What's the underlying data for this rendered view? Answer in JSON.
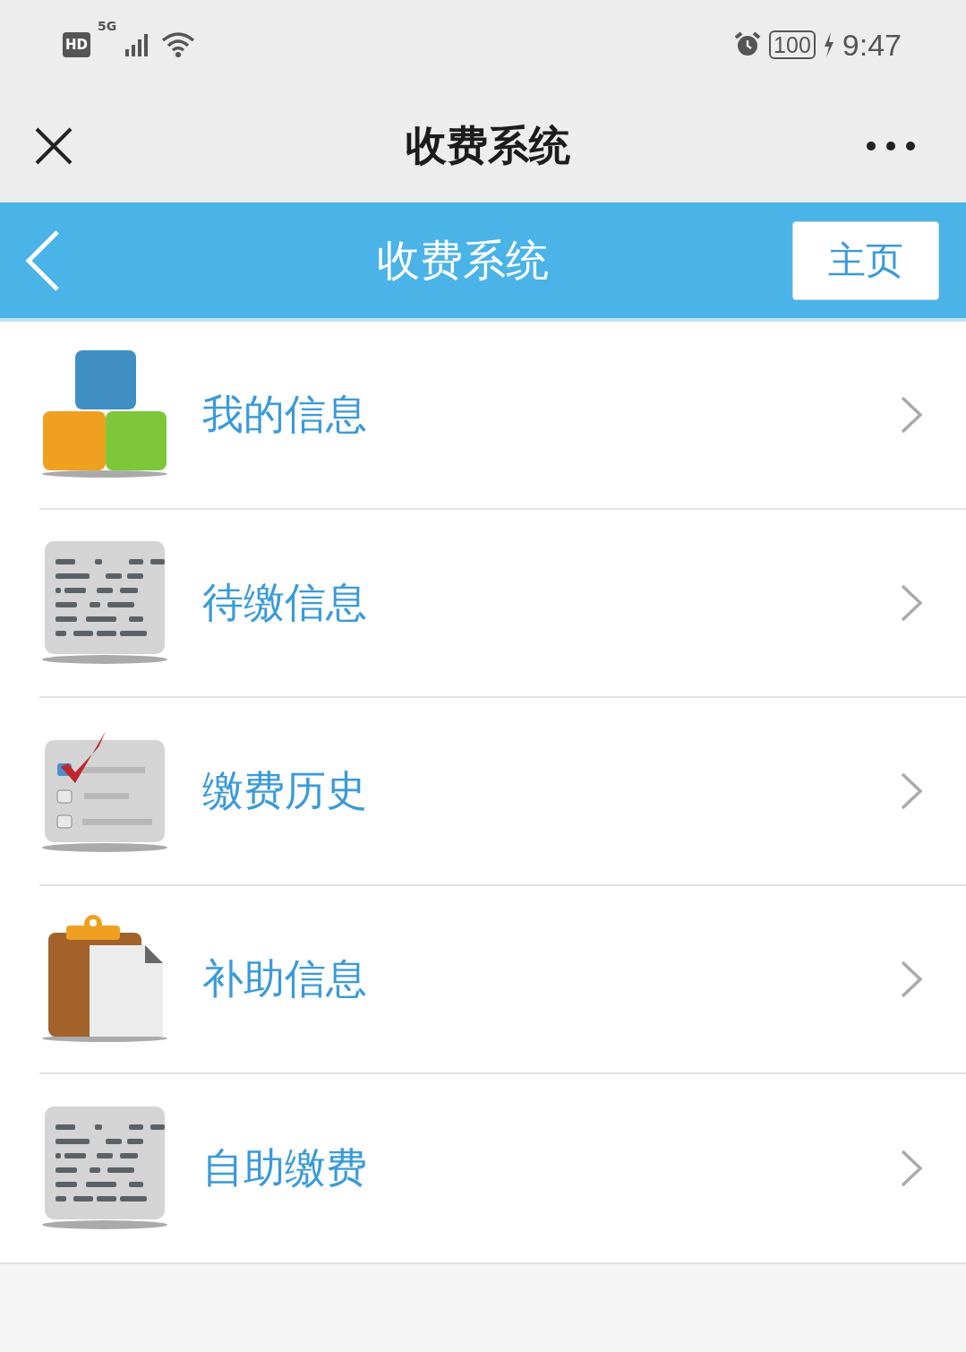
{
  "status_bar": {
    "hd": "HD",
    "network": "5G",
    "battery": "100",
    "time": "9:47"
  },
  "top_bar": {
    "title": "收费系统"
  },
  "header": {
    "title": "收费系统",
    "home_button": "主页"
  },
  "menu": [
    {
      "label": "我的信息",
      "kind": "blocks"
    },
    {
      "label": "待缴信息",
      "kind": "list"
    },
    {
      "label": "缴费历史",
      "kind": "checklist"
    },
    {
      "label": "补助信息",
      "kind": "clipboard"
    },
    {
      "label": "自助缴费",
      "kind": "list"
    }
  ]
}
